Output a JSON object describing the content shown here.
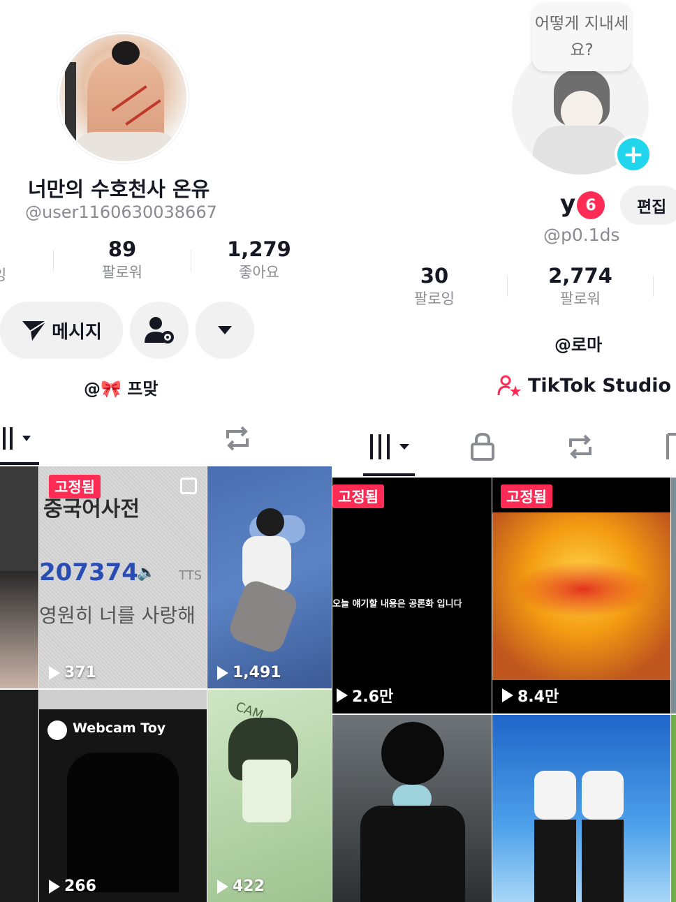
{
  "left_profile": {
    "display_name": "너만의 수호천사 온유",
    "username": "@user1160630038667",
    "stats": [
      {
        "value": "89",
        "label": "팔로워"
      },
      {
        "value": "1,279",
        "label": "좋아요"
      }
    ],
    "partial_stat_label": "잉",
    "message_button": "메시지",
    "bio_link": "@🎀 프맞",
    "videos": [
      {
        "views": "371",
        "pinned": "고정됨",
        "title": "중국어사전",
        "number": "207374",
        "tts": "TTS",
        "subtitle": "영원히 너를 사랑해"
      },
      {
        "views": "1,491"
      },
      {
        "views": "266",
        "overlay": "Webcam Toy"
      },
      {
        "views": "422",
        "overlay": "CAM"
      }
    ]
  },
  "right_profile": {
    "bubble_text": "어떻게 지내세요?",
    "plus_symbol": "+",
    "display_name": "y",
    "level_badge": "6",
    "edit_button": "편집",
    "username": "@p0.1ds",
    "stats": [
      {
        "value": "30",
        "label": "팔로잉"
      },
      {
        "value": "2,774",
        "label": "팔로워"
      }
    ],
    "bio_link": "@로마",
    "studio_label": "TikTok Studio",
    "videos": [
      {
        "views": "2.6만",
        "pinned": "고정됨",
        "caption": "오늘 얘기할 내용은 공론화 입니다"
      },
      {
        "views": "8.4만",
        "pinned": "고정됨"
      },
      {},
      {}
    ]
  },
  "colors": {
    "accent_red": "#fe2c55",
    "accent_cyan": "#20d5ec",
    "text_primary": "#161823",
    "text_secondary": "#8a8b91"
  }
}
